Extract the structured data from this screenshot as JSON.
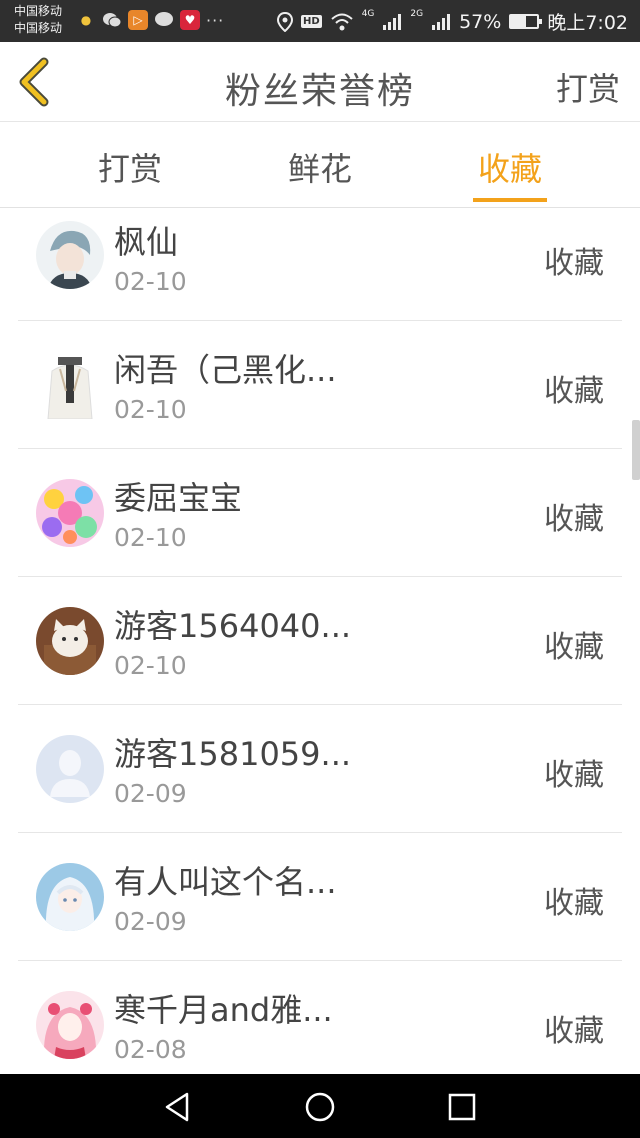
{
  "status_bar": {
    "carrier1": "中国移动",
    "carrier2": "中国移动",
    "network1": "4G",
    "network2": "2G",
    "battery": "57%",
    "battery_level": 0.57,
    "time": "晚上7:02",
    "hd_label": "HD",
    "more": "···"
  },
  "header": {
    "title": "粉丝荣誉榜",
    "action": "打赏",
    "back_icon": "chevron-left-icon"
  },
  "tabs": [
    {
      "label": "打赏",
      "active": false
    },
    {
      "label": "鲜花",
      "active": false
    },
    {
      "label": "收藏",
      "active": true
    }
  ],
  "accent_color": "#f3a21b",
  "list": [
    {
      "name": "枫仙",
      "date": "02-10",
      "type": "收藏"
    },
    {
      "name": "闲吾（己黑化...",
      "date": "02-10",
      "type": "收藏"
    },
    {
      "name": "委屈宝宝",
      "date": "02-10",
      "type": "收藏"
    },
    {
      "name": "游客1564040...",
      "date": "02-10",
      "type": "收藏"
    },
    {
      "name": "游客1581059...",
      "date": "02-09",
      "type": "收藏"
    },
    {
      "name": "有人叫这个名...",
      "date": "02-09",
      "type": "收藏"
    },
    {
      "name": "寒千月and雅...",
      "date": "02-08",
      "type": "收藏"
    }
  ]
}
